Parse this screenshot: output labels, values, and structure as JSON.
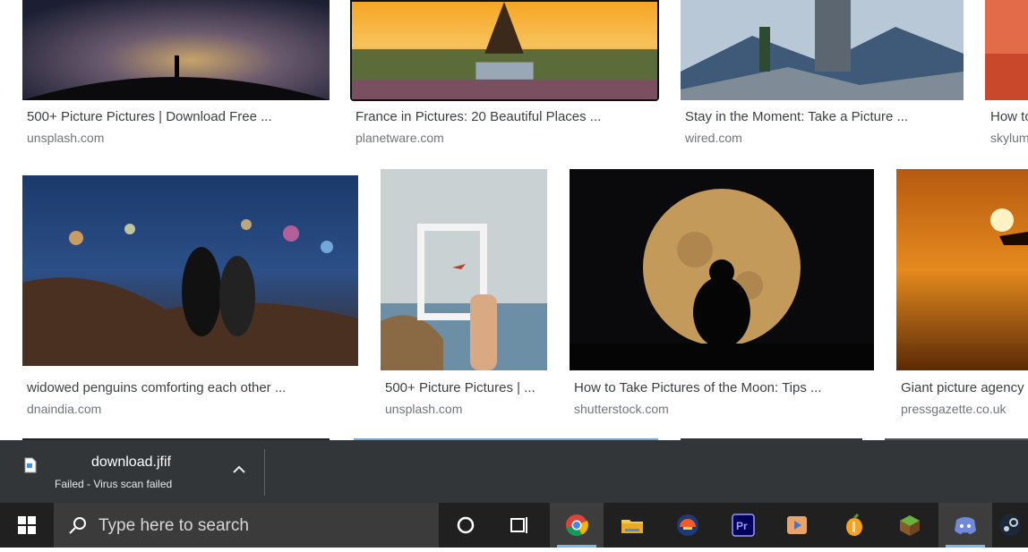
{
  "results": {
    "row1": [
      {
        "title": "500+ Picture Pictures | Download Free ...",
        "source": "unsplash.com"
      },
      {
        "title": "France in Pictures: 20 Beautiful Places ...",
        "source": "planetware.com"
      },
      {
        "title": "Stay in the Moment: Take a Picture ...",
        "source": "wired.com"
      },
      {
        "title": "How to",
        "source": "skylum"
      }
    ],
    "row2": [
      {
        "title": "widowed penguins comforting each other ...",
        "source": "dnaindia.com"
      },
      {
        "title": "500+ Picture Pictures | ...",
        "source": "unsplash.com"
      },
      {
        "title": "How to Take Pictures of the Moon: Tips ...",
        "source": "shutterstock.com"
      },
      {
        "title": "Giant picture agency",
        "source": "pressgazette.co.uk"
      }
    ]
  },
  "download": {
    "filename": "download.jfif",
    "status": "Failed - Virus scan failed"
  },
  "taskbar": {
    "search_placeholder": "Type here to search",
    "icons": [
      "windows-start-icon",
      "cortana-icon",
      "task-view-icon",
      "chrome-icon",
      "file-explorer-icon",
      "vpn-shield-icon",
      "premiere-pro-icon",
      "video-player-icon",
      "fl-studio-icon",
      "minecraft-icon",
      "discord-icon",
      "steam-icon"
    ]
  },
  "colors": {
    "download_bar": "#323639",
    "taskbar": "#202020",
    "active_underline": "#76b9ed"
  }
}
